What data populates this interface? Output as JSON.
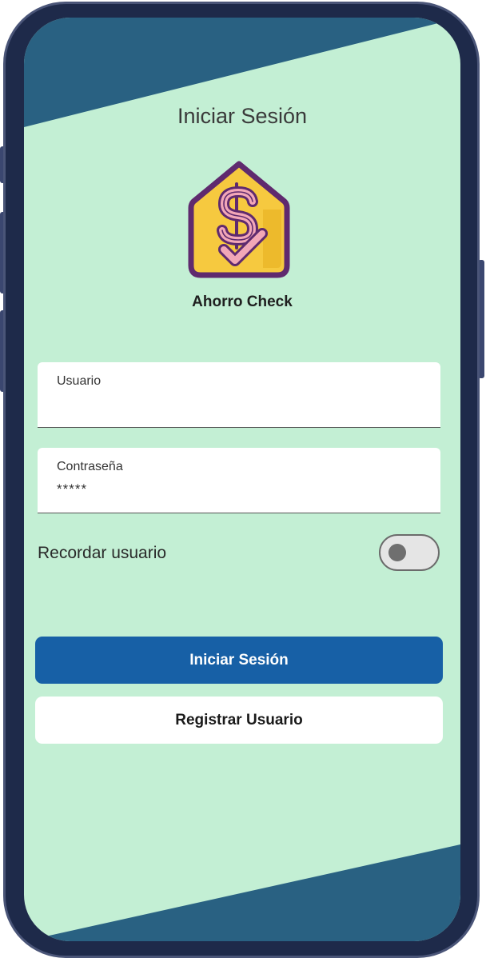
{
  "header": {
    "title": "Iniciar Sesión"
  },
  "brand": {
    "name": "Ahorro Check"
  },
  "form": {
    "username": {
      "label": "Usuario",
      "value": ""
    },
    "password": {
      "label": "Contraseña",
      "value": "*****"
    },
    "remember": {
      "label": "Recordar usuario",
      "enabled": false
    }
  },
  "actions": {
    "login_label": "Iniciar Sesión",
    "register_label": "Registrar Usuario"
  },
  "colors": {
    "background": "#c3efd4",
    "accent_band": "#296182",
    "primary_button": "#1760a6",
    "frame": "#1e2a4a",
    "logo_fill": "#f6c93f",
    "logo_outline": "#5f2a6e"
  },
  "icons": {
    "logo": "dollar-check-house-icon"
  }
}
